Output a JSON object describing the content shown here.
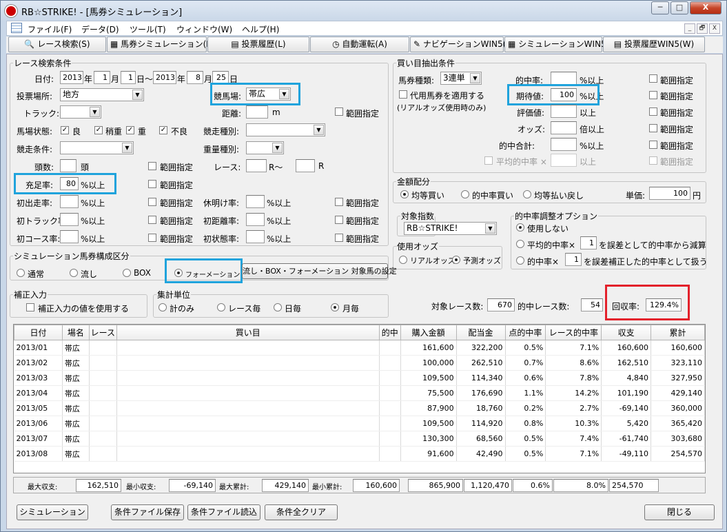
{
  "window": {
    "title": "RB☆STRIKE! - [馬券シミュレーション]",
    "min": "─",
    "max": "□",
    "close": "X"
  },
  "menu": [
    "ファイル(F)",
    "データ(D)",
    "ツール(T)",
    "ウィンドウ(W)",
    "ヘルプ(H)"
  ],
  "mdi": [
    "_",
    "🗗",
    "X"
  ],
  "toolbar": [
    "レース検索(S)",
    "馬券シミュレーション(B)",
    "投票履歴(L)",
    "自動運転(A)",
    "ナビゲーションWIN5(N)",
    "シミュレーションWIN5(I)",
    "投票履歴WIN5(W)"
  ],
  "race": {
    "legend": "レース検索条件",
    "date_label": "日付:",
    "y1": "2013",
    "m1": "1",
    "d1": "1",
    "y2": "2013",
    "m2": "8",
    "d2": "25",
    "yr": "年",
    "mo": "月",
    "dy": "日",
    "tilde": "日〜",
    "dy2": "日",
    "venue_label": "投票場所:",
    "venue": "地方",
    "track_name_label": "競馬場:",
    "track_name": "帯広",
    "track_label": "トラック:",
    "track": "",
    "distance_label": "距離:",
    "distance": "",
    "distance_unit": "m",
    "range": "範囲指定",
    "cond_label": "馬場状態:",
    "conds": [
      "良",
      "稍重",
      "重",
      "不良"
    ],
    "race_type_label": "競走種別:",
    "race_type": "",
    "race_cond_label": "競走条件:",
    "race_cond": "",
    "weight_label": "重量種別:",
    "weight": "",
    "heads_label": "頭数:",
    "heads_unit": "頭",
    "race_no_label": "レース:",
    "race_from_unit": "R〜",
    "race_to_unit": "R",
    "fill_label": "充足率:",
    "fill": "80",
    "pct_over": "%以上",
    "first_run_label": "初出走率:",
    "rest_label": "休明け率:",
    "first_track_label": "初トラック率:",
    "first_dist_label": "初距離率:",
    "first_course_label": "初コース率:",
    "first_status_label": "初状態率:"
  },
  "bet": {
    "legend": "買い目抽出条件",
    "type_label": "馬券種類:",
    "type": "3連単",
    "sub_label": "代用馬券を適用する",
    "sub_note": "(リアルオッズ使用時のみ)",
    "hit_label": "的中率:",
    "hit_unit": "%以上",
    "exp_label": "期待値:",
    "exp": "100",
    "exp_unit": "%以上",
    "eval_label": "評価値:",
    "eval_unit": "以上",
    "odds_label": "オッズ:",
    "odds_unit": "倍以上",
    "hit_total_label": "的中合計:",
    "hit_total_unit": "%以上",
    "avg_hit_label": "平均的中率 ×",
    "avg_hit_unit": "以上",
    "range": "範囲指定"
  },
  "money": {
    "legend": "金額配分",
    "opts": [
      "均等買い",
      "的中率買い",
      "均等払い戻し"
    ],
    "unit_label": "単価:",
    "unit": "100",
    "yen": "円"
  },
  "index": {
    "legend": "対象指数",
    "value": "RB☆STRIKE!"
  },
  "adj": {
    "legend": "的中率調整オプション",
    "o1": "使用しない",
    "o2a": "平均的中率×",
    "o2v": "1",
    "o2b": "を誤差として的中率から減算",
    "o3a": "的中率×",
    "o3v": "1",
    "o3b": "を誤差補正した的中率として扱う"
  },
  "oddsuse": {
    "legend": "使用オッズ",
    "opts": [
      "リアルオッズ",
      "予測オッズ"
    ]
  },
  "sim": {
    "legend": "シミュレーション馬券構成区分",
    "opts": [
      "通常",
      "流し",
      "BOX",
      "フォーメーション"
    ],
    "setting_btn": "流し・BOX・フォーメーション 対象馬の設定"
  },
  "corr": {
    "legend": "補正入力",
    "cb": "補正入力の値を使用する"
  },
  "agg": {
    "legend": "集計単位",
    "opts": [
      "計のみ",
      "レース毎",
      "日毎",
      "月毎"
    ]
  },
  "stats": {
    "races_label": "対象レース数:",
    "races": "670",
    "hits_label": "的中レース数:",
    "hits": "54",
    "roi_label": "回収率:",
    "roi": "129.4%"
  },
  "table": {
    "headers": [
      "日付",
      "場名",
      "レース",
      "買い目",
      "的中",
      "購入金額",
      "配当金",
      "点的中率",
      "レース的中率",
      "収支",
      "累計"
    ],
    "rows": [
      [
        "2013/01",
        "帯広",
        "",
        "",
        "",
        "161,600",
        "322,200",
        "0.5%",
        "7.1%",
        "160,600",
        "160,600"
      ],
      [
        "2013/02",
        "帯広",
        "",
        "",
        "",
        "100,000",
        "262,510",
        "0.7%",
        "8.6%",
        "162,510",
        "323,110"
      ],
      [
        "2013/03",
        "帯広",
        "",
        "",
        "",
        "109,500",
        "114,340",
        "0.6%",
        "7.8%",
        "4,840",
        "327,950"
      ],
      [
        "2013/04",
        "帯広",
        "",
        "",
        "",
        "75,500",
        "176,690",
        "1.1%",
        "14.2%",
        "101,190",
        "429,140"
      ],
      [
        "2013/05",
        "帯広",
        "",
        "",
        "",
        "87,900",
        "18,760",
        "0.2%",
        "2.7%",
        "-69,140",
        "360,000"
      ],
      [
        "2013/06",
        "帯広",
        "",
        "",
        "",
        "109,500",
        "114,920",
        "0.8%",
        "10.3%",
        "5,420",
        "365,420"
      ],
      [
        "2013/07",
        "帯広",
        "",
        "",
        "",
        "130,300",
        "68,560",
        "0.5%",
        "7.4%",
        "-61,740",
        "303,680"
      ],
      [
        "2013/08",
        "帯広",
        "",
        "",
        "",
        "91,600",
        "42,490",
        "0.5%",
        "7.1%",
        "-49,110",
        "254,570"
      ]
    ]
  },
  "summary": {
    "max_income_label": "最大収支:",
    "max_income": "162,510",
    "min_income_label": "最小収支:",
    "min_income": "-69,140",
    "max_cum_label": "最大累計:",
    "max_cum": "429,140",
    "min_cum_label": "最小累計:",
    "min_cum": "160,600",
    "total_buy": "865,900",
    "total_pay": "1,120,470",
    "total_pt": "0.6%",
    "total_race": "8.0%",
    "total_income": "254,570"
  },
  "buttons": {
    "simulate": "シミュレーション",
    "save": "条件ファイル保存",
    "load": "条件ファイル読込",
    "clear": "条件全クリア",
    "close": "閉じる"
  }
}
